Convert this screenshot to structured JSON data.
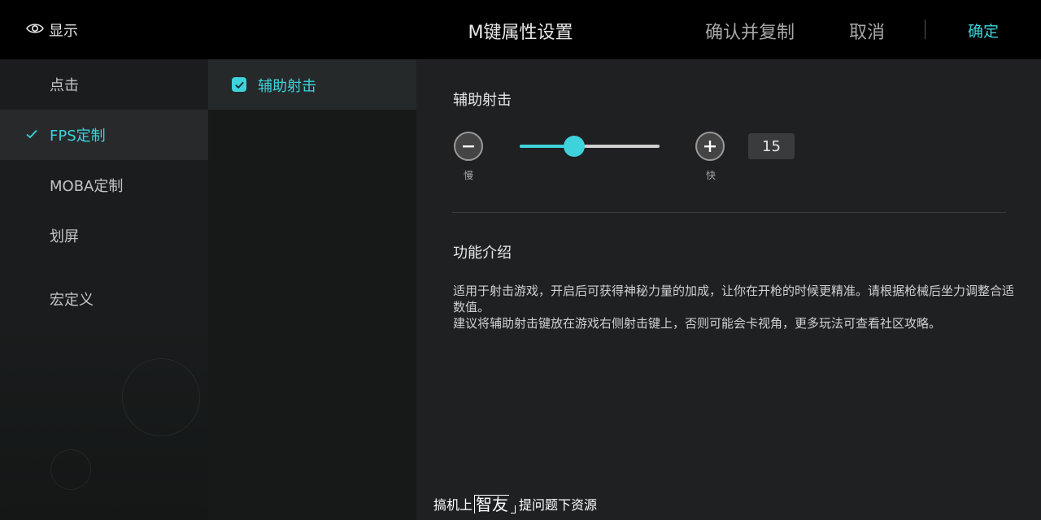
{
  "topbar": {
    "show_label": "显示",
    "title": "M键属性设置",
    "confirm_copy": "确认并复制",
    "cancel": "取消",
    "ok": "确定"
  },
  "menu": {
    "items": [
      {
        "label": "点击",
        "active": false
      },
      {
        "label": "FPS定制",
        "active": true
      },
      {
        "label": "MOBA定制",
        "active": false
      },
      {
        "label": "划屏",
        "active": false
      },
      {
        "label": "宏定义",
        "active": false
      }
    ]
  },
  "submenu": {
    "item_label": "辅助射击",
    "checked": true
  },
  "panel": {
    "section_title": "辅助射击",
    "slow_label": "慢",
    "fast_label": "快",
    "value": "15",
    "slider_fraction": 0.39,
    "intro_title": "功能介绍",
    "desc_line1": "适用于射击游戏，开启后可获得神秘力量的加成，让你在开枪的时候更精准。请根据枪械后坐力调整合适数值。",
    "desc_line2": "建议将辅助射击键放在游戏右侧射击键上，否则可能会卡视角，更多玩法可查看社区攻略。"
  },
  "watermark": {
    "pre": "搞机上",
    "big": "智友",
    "post": "提问题下资源"
  },
  "colors": {
    "accent": "#3ed3dc",
    "topbar_bg": "#000000",
    "panel_bg": "#1f2022"
  }
}
